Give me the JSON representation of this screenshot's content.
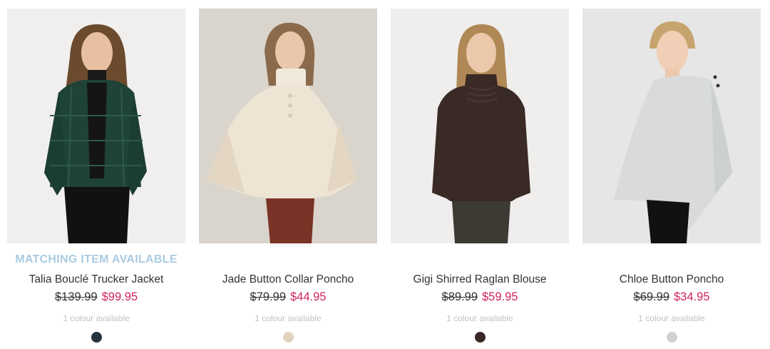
{
  "products": [
    {
      "badge": "MATCHING ITEM AVAILABLE",
      "name": "Talia Bouclé Trucker Jacket",
      "old_price": "$139.99",
      "new_price": "$99.95",
      "colours": "1 colour available",
      "swatch_color": "#25333d",
      "image": "woman-green-plaid-jacket"
    },
    {
      "name": "Jade Button Collar Poncho",
      "old_price": "$79.99",
      "new_price": "$44.95",
      "colours": "1 colour available",
      "swatch_color": "#e2d2bd",
      "image": "woman-cream-poncho"
    },
    {
      "name": "Gigi Shirred Raglan Blouse",
      "old_price": "$89.99",
      "new_price": "$59.95",
      "colours": "1 colour available",
      "swatch_color": "#3a2726",
      "image": "woman-brown-blouse"
    },
    {
      "name": "Chloe Button Poncho",
      "old_price": "$69.99",
      "new_price": "$34.95",
      "colours": "1 colour available",
      "swatch_color": "#d2d2d2",
      "image": "woman-grey-poncho"
    }
  ],
  "colors": {
    "badge": "#a9cbe1",
    "sale_price": "#d0245c",
    "text": "#333333",
    "muted": "#c2c2c2"
  }
}
